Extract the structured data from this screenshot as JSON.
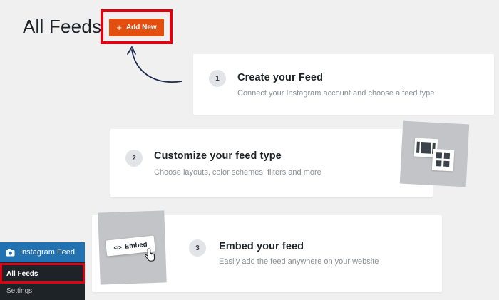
{
  "header": {
    "title": "All Feeds",
    "add_new_label": "Add New",
    "add_new_icon": "plus-icon"
  },
  "steps": [
    {
      "number": "1",
      "title": "Create your Feed",
      "description": "Connect your Instagram account and choose a feed type"
    },
    {
      "number": "2",
      "title": "Customize your feed type",
      "description": "Choose layouts, color schemes, filters and more"
    },
    {
      "number": "3",
      "title": "Embed your feed",
      "description": "Easily add the feed anywhere on your website"
    }
  ],
  "embed_badge": {
    "icon": "code-icon",
    "label": "Embed"
  },
  "sidebar": {
    "plugin_label": "Instagram Feed",
    "plugin_icon": "camera-icon",
    "items": [
      {
        "label": "All Feeds",
        "active": true
      },
      {
        "label": "Settings",
        "active": false
      }
    ]
  },
  "colors": {
    "accent_orange": "#e34f0e",
    "highlight_red": "#e00010",
    "sidebar_blue": "#2271b1",
    "sidebar_dark": "#1d2327"
  }
}
